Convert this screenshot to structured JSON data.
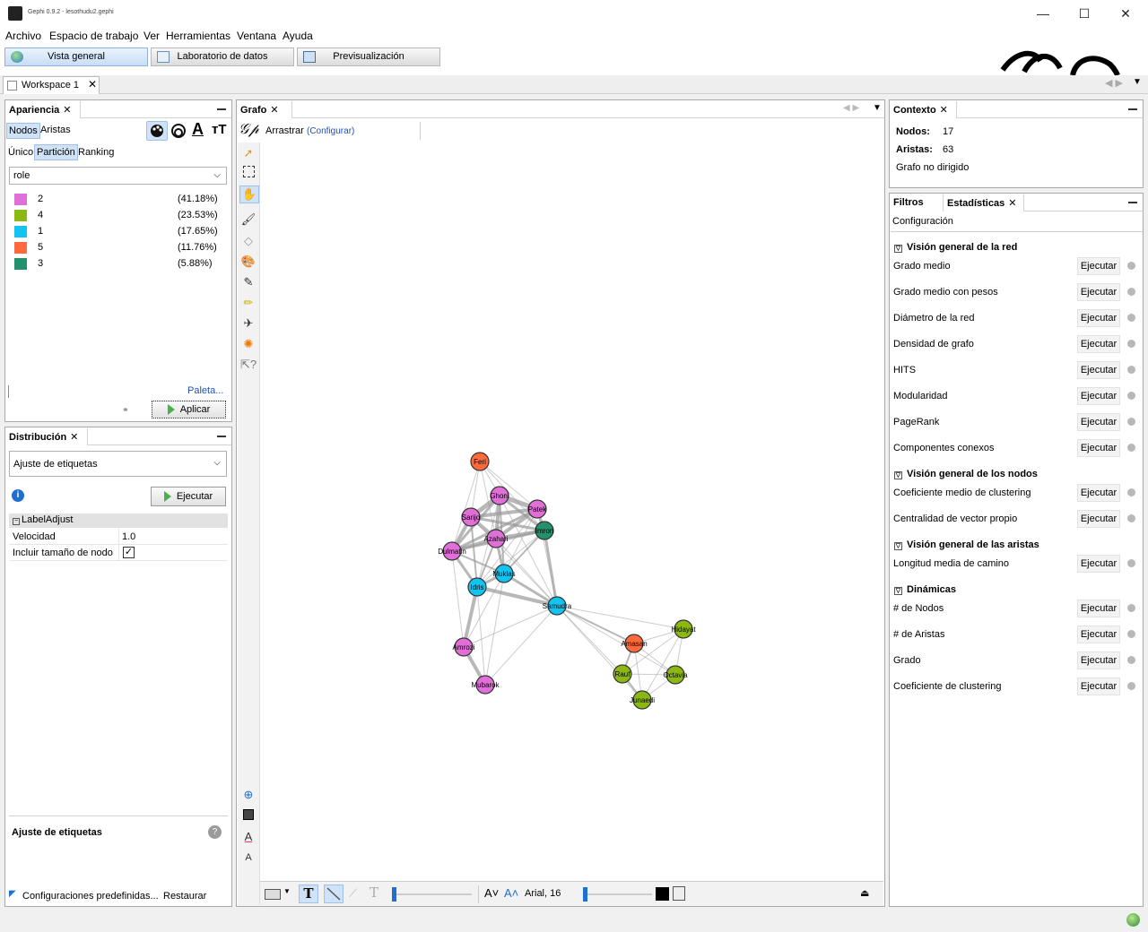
{
  "window": {
    "title": "Gephi 0.9.2 - lesothudu2.gephi",
    "controls": {
      "minimize": "—",
      "maximize": "☐",
      "close": "✕"
    }
  },
  "menu": [
    "Archivo",
    "Espacio de trabajo",
    "Ver",
    "Herramientas",
    "Ventana",
    "Ayuda"
  ],
  "modes": [
    "Vista general",
    "Laboratorio de datos",
    "Previsualización"
  ],
  "workspace_tab": "Workspace 1",
  "appearance": {
    "title": "Apariencia",
    "elem_tabs": [
      "Nodos",
      "Aristas"
    ],
    "mode_tabs": [
      "Único",
      "Partición",
      "Ranking"
    ],
    "attribute": "role",
    "partitions": [
      {
        "label": "2",
        "pct": "(41.18%)",
        "color": "#e070d8"
      },
      {
        "label": "4",
        "pct": "(23.53%)",
        "color": "#8cb814"
      },
      {
        "label": "1",
        "pct": "(17.65%)",
        "color": "#14c4f0"
      },
      {
        "label": "5",
        "pct": "(11.76%)",
        "color": "#ff6a3c"
      },
      {
        "label": "3",
        "pct": "(5.88%)",
        "color": "#23906e"
      }
    ],
    "palette_link": "Paleta...",
    "apply": "Aplicar"
  },
  "layout": {
    "title": "Distribución",
    "algorithm": "Ajuste de etiquetas",
    "run": "Ejecutar",
    "group": "LabelAdjust",
    "props": [
      {
        "name": "Velocidad",
        "value": "1.0"
      },
      {
        "name": "Incluir tamaño de nodo",
        "value": "✓"
      }
    ],
    "desc_title": "Ajuste de etiquetas",
    "presets": "Configuraciones predefinidas...",
    "reset": "Restaurar"
  },
  "graph": {
    "title": "Grafo",
    "tool": "Arrastrar",
    "config": "(Configurar)",
    "font": "Arial, 16",
    "nodes": [
      {
        "id": "Feri",
        "role": "5"
      },
      {
        "id": "Ghoni",
        "role": "2"
      },
      {
        "id": "Patek",
        "role": "2"
      },
      {
        "id": "Sarijo",
        "role": "2"
      },
      {
        "id": "Imron",
        "role": "3"
      },
      {
        "id": "Azahari",
        "role": "2"
      },
      {
        "id": "Dulmatin",
        "role": "2"
      },
      {
        "id": "Muklas",
        "role": "1"
      },
      {
        "id": "Idris",
        "role": "1"
      },
      {
        "id": "Samudra",
        "role": "1"
      },
      {
        "id": "Amrozi",
        "role": "2"
      },
      {
        "id": "Mubarok",
        "role": "2"
      },
      {
        "id": "Hidayat",
        "role": "4"
      },
      {
        "id": "Amasan",
        "role": "5"
      },
      {
        "id": "Rauf",
        "role": "4"
      },
      {
        "id": "Octavia",
        "role": "4"
      },
      {
        "id": "Junaedi",
        "role": "4"
      }
    ]
  },
  "context": {
    "title": "Contexto",
    "nodes_label": "Nodos:",
    "nodes": "17",
    "edges_label": "Aristas:",
    "edges": "63",
    "type": "Grafo no dirigido"
  },
  "stats": {
    "tabs": [
      "Filtros",
      "Estadísticas"
    ],
    "config": "Configuración",
    "run_label": "Ejecutar",
    "sections": [
      {
        "title": "Visión general de la red",
        "items": [
          "Grado medio",
          "Grado medio con pesos",
          "Diámetro de la red",
          "Densidad de grafo",
          "HITS",
          "Modularidad",
          "PageRank",
          "Componentes conexos"
        ]
      },
      {
        "title": "Visión general de los nodos",
        "items": [
          "Coeficiente medio de clustering",
          "Centralidad de vector propio"
        ]
      },
      {
        "title": "Visión general de las aristas",
        "items": [
          "Longitud media de camino"
        ]
      },
      {
        "title": "Dinámicas",
        "items": [
          "# de Nodos",
          "# de Aristas",
          "Grado",
          "Coeficiente de clustering"
        ]
      }
    ]
  }
}
